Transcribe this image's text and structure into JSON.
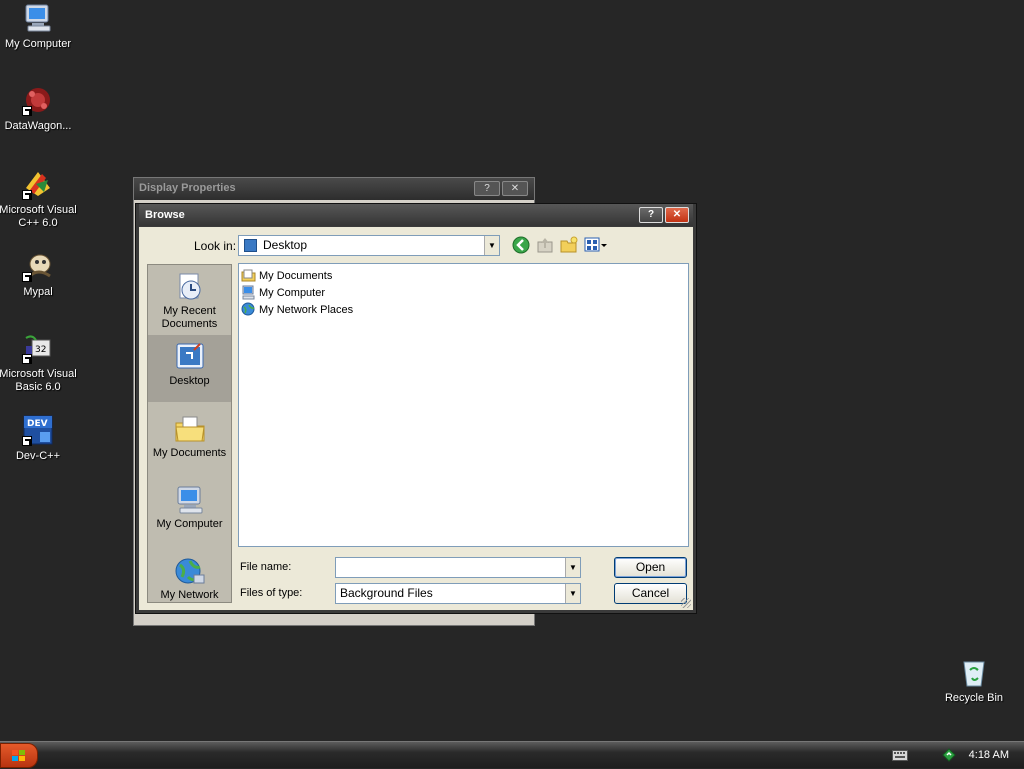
{
  "desktop": {
    "icons": [
      {
        "label": "My Computer",
        "icon": "computer-icon"
      },
      {
        "label": "DataWagon...",
        "icon": "datawagon-icon"
      },
      {
        "label": "Microsoft Visual C++ 6.0",
        "icon": "visual-cpp-icon"
      },
      {
        "label": "Mypal",
        "icon": "mypal-icon"
      },
      {
        "label": "Microsoft Visual Basic 6.0",
        "icon": "visual-basic-icon"
      },
      {
        "label": "Dev-C++",
        "icon": "devcpp-icon"
      }
    ],
    "recycle_bin": {
      "label": "Recycle Bin",
      "icon": "recycle-bin-icon"
    }
  },
  "display_properties": {
    "title": "Display Properties",
    "help": "?",
    "close": "✕"
  },
  "browse": {
    "title": "Browse",
    "help": "?",
    "close": "✕",
    "look_in_label": "Look in:",
    "look_in_value": "Desktop",
    "places": [
      {
        "label": "My Recent Documents",
        "icon": "recent-documents-icon"
      },
      {
        "label": "Desktop",
        "icon": "desktop-icon"
      },
      {
        "label": "My Documents",
        "icon": "my-documents-icon"
      },
      {
        "label": "My Computer",
        "icon": "computer-icon"
      },
      {
        "label": "My Network",
        "icon": "network-icon"
      }
    ],
    "selected_place": "Desktop",
    "files": [
      {
        "name": "My Documents",
        "icon": "folder-icon"
      },
      {
        "name": "My Computer",
        "icon": "computer-icon"
      },
      {
        "name": "My Network Places",
        "icon": "network-icon"
      }
    ],
    "file_name_label": "File name:",
    "file_name_value": "",
    "files_of_type_label": "Files of type:",
    "files_of_type_value": "Background Files",
    "open_label": "Open",
    "cancel_label": "Cancel"
  },
  "taskbar": {
    "clock": "4:18 AM",
    "tray_icons": [
      "keyboard-icon",
      "network-tray-icon"
    ]
  },
  "colors": {
    "desktop_background": "#262626",
    "dialog_face": "#ece9d8",
    "start_button": "#d84b1f"
  }
}
